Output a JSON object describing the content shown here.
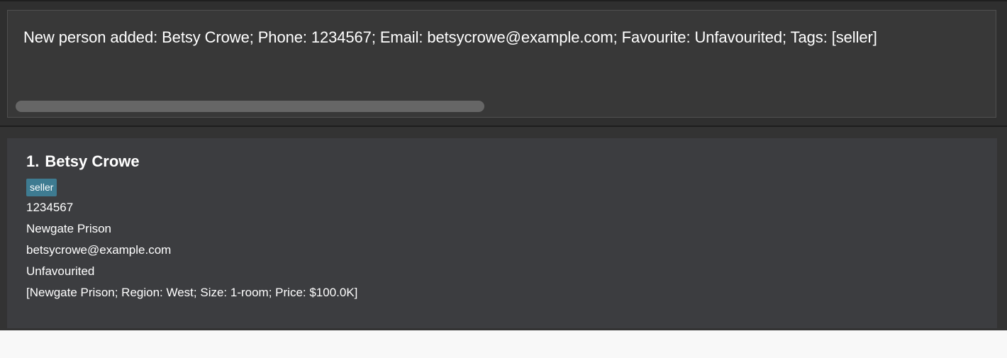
{
  "result_display": {
    "text": "New person added: Betsy Crowe; Phone: 1234567; Email: betsycrowe@example.com; Favourite: Unfavourited; Tags: [seller]"
  },
  "person_list": [
    {
      "index": "1.",
      "name": "Betsy Crowe",
      "tags": [
        "seller"
      ],
      "phone": "1234567",
      "address": "Newgate Prison",
      "email": "betsycrowe@example.com",
      "favourite": "Unfavourited",
      "properties": "[Newgate Prison; Region: West; Size: 1-room; Price: $100.0K]"
    }
  ]
}
